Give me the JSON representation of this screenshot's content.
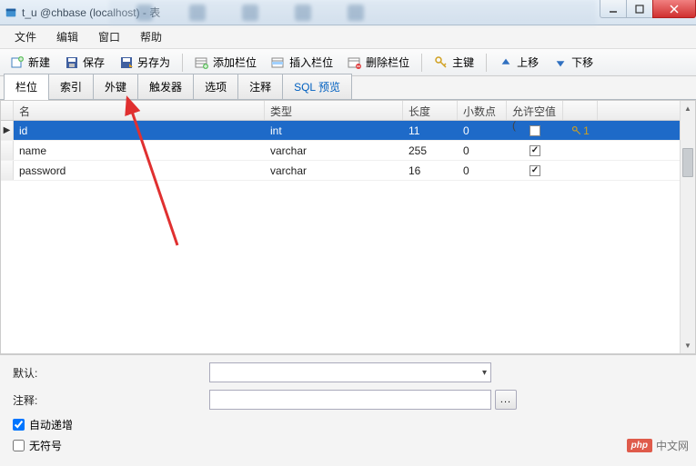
{
  "window": {
    "title": "t_u @chbase (localhost) - 表"
  },
  "menu": {
    "file": "文件",
    "edit": "编辑",
    "window": "窗口",
    "help": "帮助"
  },
  "toolbar": {
    "new": "新建",
    "save": "保存",
    "save_as": "另存为",
    "add_field": "添加栏位",
    "insert_field": "插入栏位",
    "delete_field": "删除栏位",
    "primary_key": "主键",
    "move_up": "上移",
    "move_down": "下移"
  },
  "tabs": {
    "fields": "栏位",
    "index": "索引",
    "foreign_key": "外键",
    "trigger": "触发器",
    "options": "选项",
    "comment": "注释",
    "sql_preview": "SQL 预览"
  },
  "grid": {
    "headers": {
      "name": "名",
      "type": "类型",
      "length": "长度",
      "decimal": "小数点",
      "allow_null": "允许空值 ("
    },
    "rows": [
      {
        "name": "id",
        "type": "int",
        "length": "11",
        "decimal": "0",
        "null": false,
        "key": "1",
        "selected": true
      },
      {
        "name": "name",
        "type": "varchar",
        "length": "255",
        "decimal": "0",
        "null": true,
        "key": "",
        "selected": false
      },
      {
        "name": "password",
        "type": "varchar",
        "length": "16",
        "decimal": "0",
        "null": true,
        "key": "",
        "selected": false
      }
    ]
  },
  "form": {
    "default_label": "默认:",
    "comment_label": "注释:",
    "auto_increment": "自动递增",
    "unsigned": "无符号",
    "auto_increment_checked": true,
    "unsigned_checked": false
  },
  "watermark": {
    "badge": "php",
    "text": "中文网"
  }
}
